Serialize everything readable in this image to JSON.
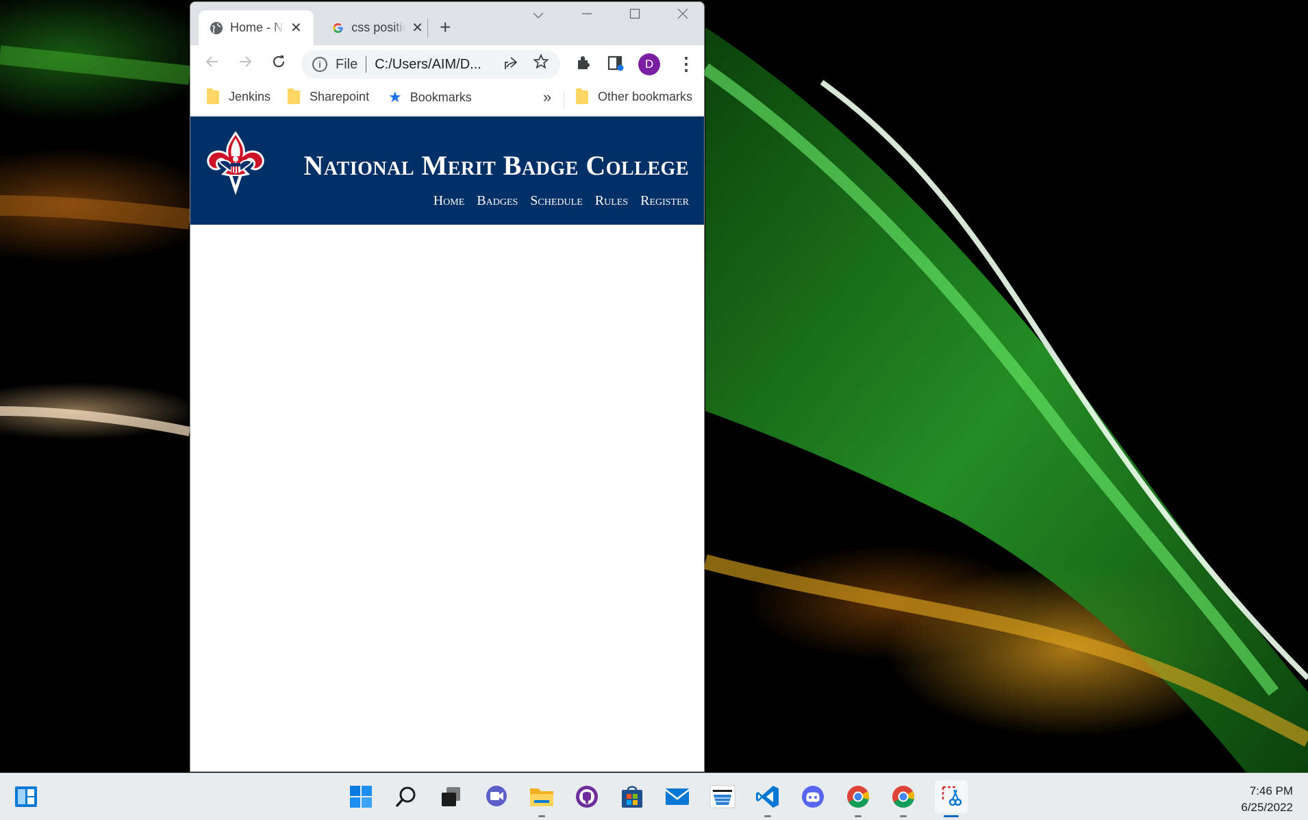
{
  "browser": {
    "tabs": [
      {
        "title": "Home - National Merit Badge College",
        "close": "✕",
        "icon": "globe-icon",
        "active": true
      },
      {
        "title": "css position",
        "close": "✕",
        "icon": "google-icon",
        "active": false
      }
    ],
    "new_tab": "+",
    "window_controls": {
      "minimize": "—",
      "maximize": "☐",
      "close": "✕"
    },
    "omnibox": {
      "scheme": "File",
      "url": "C:/Users/AIM/D..."
    },
    "profile_initial": "D",
    "bookmarks": [
      "Jenkins",
      "Sharepoint",
      "Bookmarks"
    ],
    "bookmarks_overflow": "»",
    "other_bookmarks": "Other bookmarks",
    "colors": {
      "tabstrip": "#dee1e6",
      "profile": "#7b1fa2",
      "bookmark_star": "#1a73e8"
    }
  },
  "site": {
    "title": "National Merit Badge College",
    "nav": [
      "Home",
      "Badges",
      "Schedule",
      "Rules",
      "Register"
    ],
    "colors": {
      "header_bg": "#003066"
    }
  },
  "taskbar": {
    "apps": [
      "widgets-icon",
      "start-icon",
      "search-icon",
      "task-view-icon",
      "chat-icon",
      "file-explorer-icon",
      "github-desktop-icon",
      "microsoft-store-icon",
      "mail-icon",
      "amazon-icon",
      "vscode-icon",
      "discord-icon",
      "chrome-icon",
      "chrome-icon",
      "snipping-tool-icon"
    ],
    "time": "7:46 PM",
    "date": "6/25/2022"
  }
}
